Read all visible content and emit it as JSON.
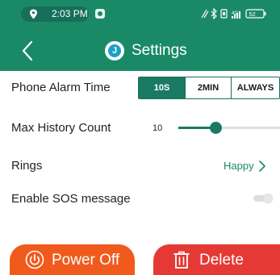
{
  "status_bar": {
    "time": "2:03 PM",
    "icons": [
      "location-pin-icon",
      "app-notification-icon",
      "nfc-icon",
      "bluetooth-icon",
      "vibrate-icon",
      "wifi-icon",
      "signal-icon",
      "battery-icon"
    ],
    "battery": "52"
  },
  "header": {
    "title": "Settings",
    "back_icon": "chevron-left-icon",
    "logo_letter": "J",
    "color": "#1a8a66"
  },
  "settings": {
    "phone_alarm_time": {
      "label": "Phone Alarm Time",
      "options": [
        "10S",
        "2MIN",
        "ALWAYS"
      ],
      "selected": "10S"
    },
    "max_history_count": {
      "label": "Max History Count",
      "value": "10",
      "level": 0.37
    },
    "rings": {
      "label": "Rings",
      "value": "Happy"
    },
    "sos": {
      "label": "Enable SOS message",
      "enabled": false
    }
  },
  "buttons": {
    "power_off": {
      "label": "Power Off",
      "icon": "power-icon",
      "color": "#f05a1c"
    },
    "delete": {
      "label": "Delete",
      "icon": "trash-icon",
      "color": "#e53935"
    }
  }
}
